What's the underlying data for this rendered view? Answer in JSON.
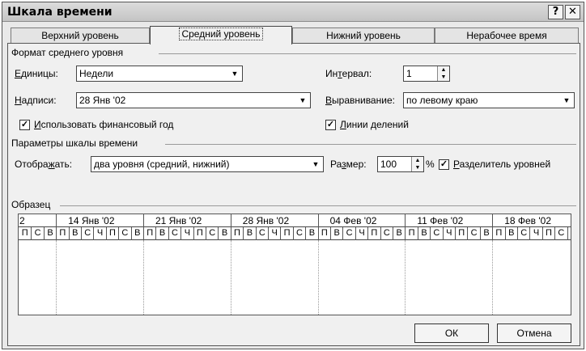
{
  "dialog": {
    "title": "Шкала времени",
    "help_btn": "?",
    "close_btn": "✕"
  },
  "tabs": [
    "Верхний уровень",
    "Средний уровень",
    "Нижний уровень",
    "Нерабочее время"
  ],
  "active_tab": "Средний уровень",
  "format": {
    "group_title": "Формат среднего уровня",
    "units_label": "Единицы:",
    "units_value": "Недели",
    "interval_label": "Интервал:",
    "interval_value": "1",
    "labels_label": "Надписи:",
    "labels_value": "28 Янв '02",
    "align_label": "Выравнивание:",
    "align_value": "по левому краю",
    "fiscal_label": "Использовать финансовый год",
    "fiscal_checked": true,
    "ticks_label": "Линии делений",
    "ticks_checked": true
  },
  "params": {
    "group_title": "Параметры шкалы времени",
    "show_label": "Отображать:",
    "show_value": "два уровня (средний, нижний)",
    "size_label": "Размер:",
    "size_value": "100",
    "size_unit": "%",
    "separator_label": "Разделитель уровней",
    "separator_checked": true
  },
  "sample": {
    "group_title": "Образец",
    "lead_label": "2",
    "lead_days": [
      "П",
      "С",
      "В"
    ],
    "weeks": [
      "14 Янв '02",
      "21 Янв '02",
      "28 Янв '02",
      "04 Фев '02",
      "11 Фев '02",
      "18 Фев '02"
    ],
    "days": [
      "П",
      "В",
      "С",
      "Ч",
      "П",
      "С",
      "В"
    ]
  },
  "buttons": {
    "ok": "ОК",
    "cancel": "Отмена"
  }
}
